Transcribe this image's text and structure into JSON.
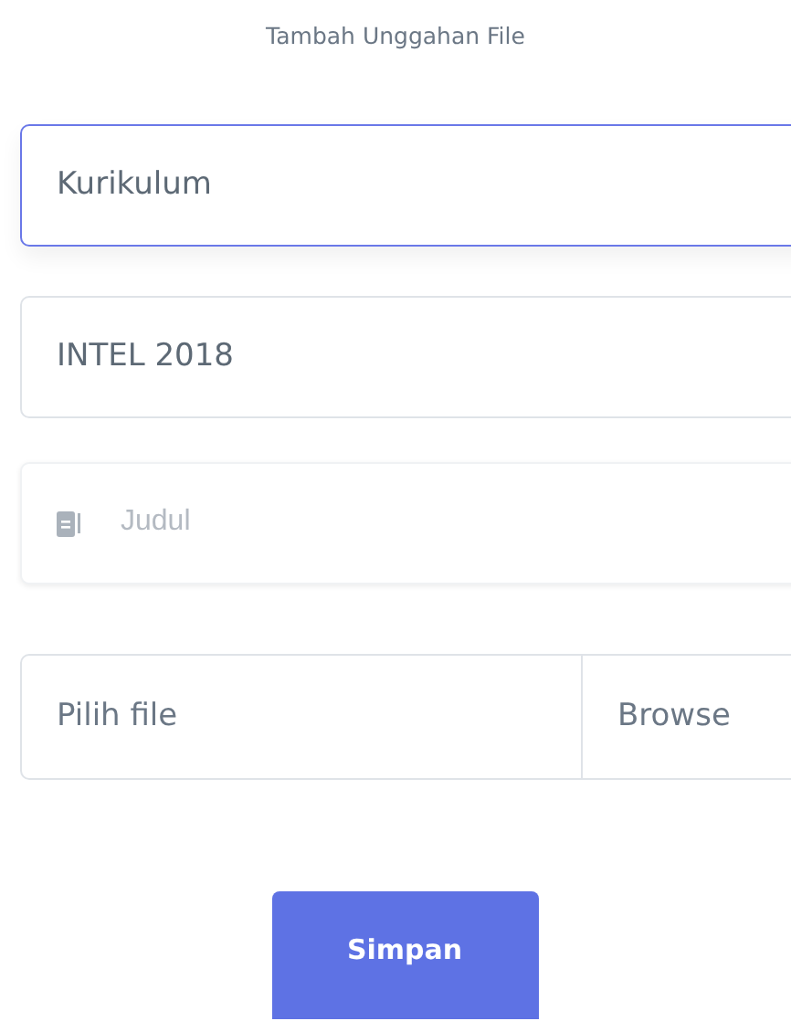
{
  "title": "Tambah Unggahan File",
  "fields": [
    {
      "kind": "value",
      "text": "Kurikulum",
      "focused": true
    },
    {
      "kind": "value",
      "text": "INTEL 2018",
      "focused": false
    },
    {
      "kind": "placeholder",
      "placeholder": "Judul",
      "focused": false
    }
  ],
  "file_input": {
    "placeholder": "Pilih file",
    "button": "Browse"
  },
  "submit": "Simpan"
}
